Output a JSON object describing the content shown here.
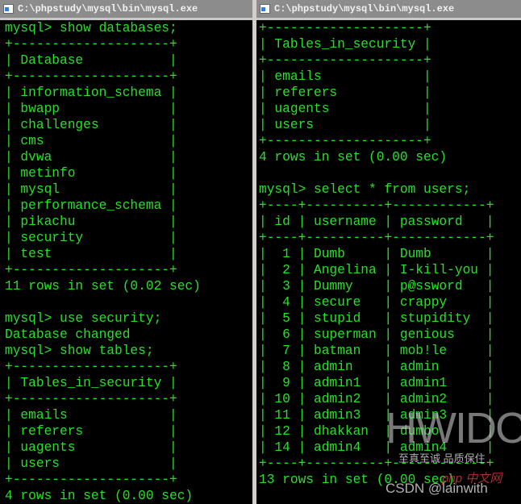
{
  "left_window": {
    "title": "C:\\phpstudy\\mysql\\bin\\mysql.exe",
    "lines": [
      "mysql> show databases;",
      "+--------------------+",
      "| Database           |",
      "+--------------------+",
      "| information_schema |",
      "| bwapp              |",
      "| challenges         |",
      "| cms                |",
      "| dvwa               |",
      "| metinfo            |",
      "| mysql              |",
      "| performance_schema |",
      "| pikachu            |",
      "| security           |",
      "| test               |",
      "+--------------------+",
      "11 rows in set (0.02 sec)",
      "",
      "mysql> use security;",
      "Database changed",
      "mysql> show tables;",
      "+--------------------+",
      "| Tables_in_security |",
      "+--------------------+",
      "| emails             |",
      "| referers           |",
      "| uagents            |",
      "| users              |",
      "+--------------------+",
      "4 rows in set (0.00 sec)"
    ]
  },
  "right_window": {
    "title": "C:\\phpstudy\\mysql\\bin\\mysql.exe",
    "lines_before": [
      "+--------------------+",
      "| Tables_in_security |",
      "+--------------------+",
      "| emails             |",
      "| referers           |",
      "| uagents            |",
      "| users              |",
      "+--------------------+",
      "4 rows in set (0.00 sec)",
      "",
      "mysql> select * from users;"
    ],
    "table": {
      "columns": [
        "id",
        "username",
        "password"
      ],
      "rows": [
        [
          "1",
          "Dumb",
          "Dumb"
        ],
        [
          "2",
          "Angelina",
          "I-kill-you"
        ],
        [
          "3",
          "Dummy",
          "p@ssword"
        ],
        [
          "4",
          "secure",
          "crappy"
        ],
        [
          "5",
          "stupid",
          "stupidity"
        ],
        [
          "6",
          "superman",
          "genious"
        ],
        [
          "7",
          "batman",
          "mob!le"
        ],
        [
          "8",
          "admin",
          "admin"
        ],
        [
          "9",
          "admin1",
          "admin1"
        ],
        [
          "10",
          "admin2",
          "admin2"
        ],
        [
          "11",
          "admin3",
          "admin3"
        ],
        [
          "12",
          "dhakkan",
          "dumbo"
        ],
        [
          "14",
          "admin4",
          "admin4"
        ]
      ]
    },
    "footer": "13 rows in set (0.00 sec)"
  },
  "watermarks": [
    "HWIDC",
    "至真至诚 品质保住",
    "php 中文网",
    "CSDN @lainwith"
  ],
  "colors": {
    "console_bg": "#000000",
    "console_text": "#27e027",
    "titlebar": "#8c8c8c"
  }
}
